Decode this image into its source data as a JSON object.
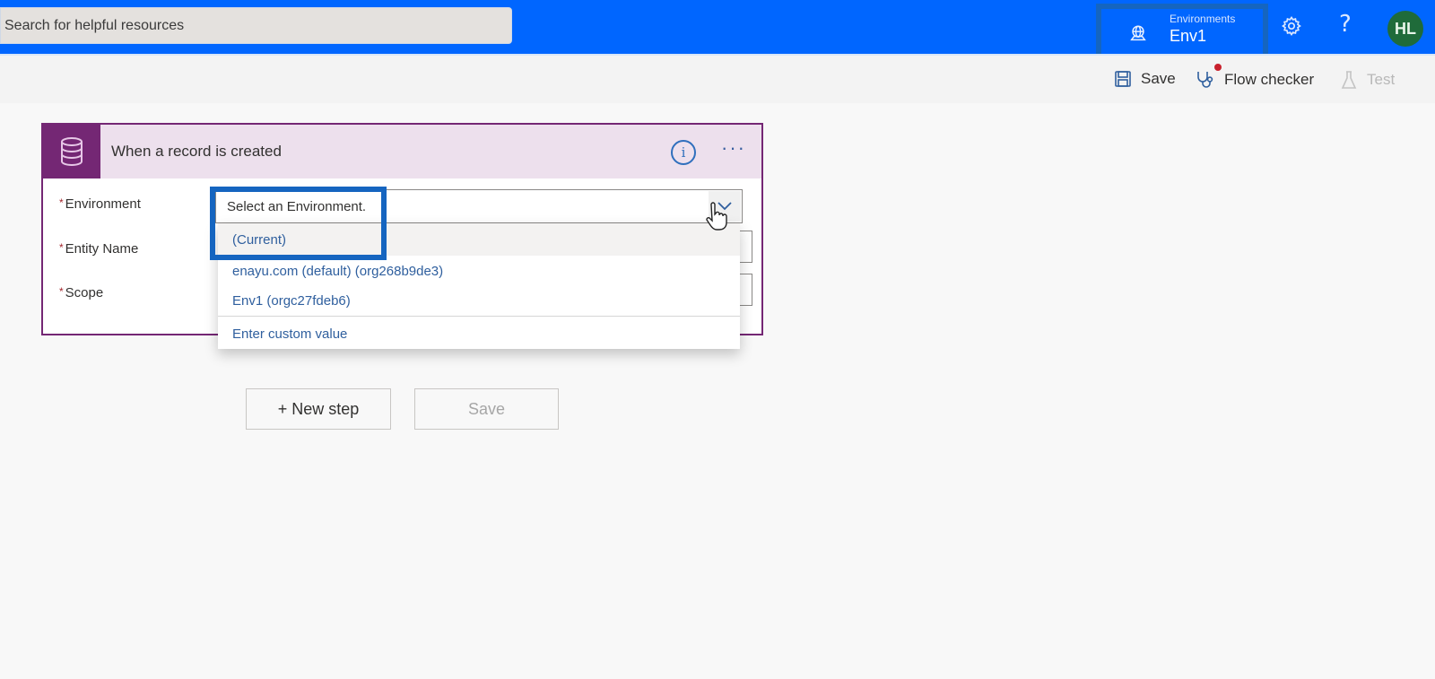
{
  "topbar": {
    "search_placeholder": "Search for helpful resources",
    "environment": {
      "label": "Environments",
      "value": "Env1",
      "icon": "globe-environment-icon"
    },
    "settings_icon": "gear-icon",
    "help_icon": "help-icon",
    "help_glyph": "?",
    "avatar_initials": "HL",
    "colors": {
      "bar": "#0066ff",
      "avatar": "#1f6b3a",
      "highlight": "#1565c0"
    }
  },
  "commandbar": {
    "save_label": "Save",
    "flow_checker_label": "Flow checker",
    "test_label": "Test"
  },
  "trigger": {
    "title": "When a record is created",
    "icon": "database-icon",
    "accent": "#742774",
    "fields": [
      {
        "label": "Environment",
        "required": "*"
      },
      {
        "label": "Entity Name",
        "required": "*"
      },
      {
        "label": "Scope",
        "required": "*"
      }
    ],
    "environment_placeholder": "Select an Environment.",
    "dropdown_options": [
      "(Current)",
      "enayu.com (default) (org268b9de3)",
      "Env1 (orgc27fdeb6)",
      "Enter custom value"
    ]
  },
  "actions": {
    "new_step_label": "+ New step",
    "save_label": "Save"
  }
}
